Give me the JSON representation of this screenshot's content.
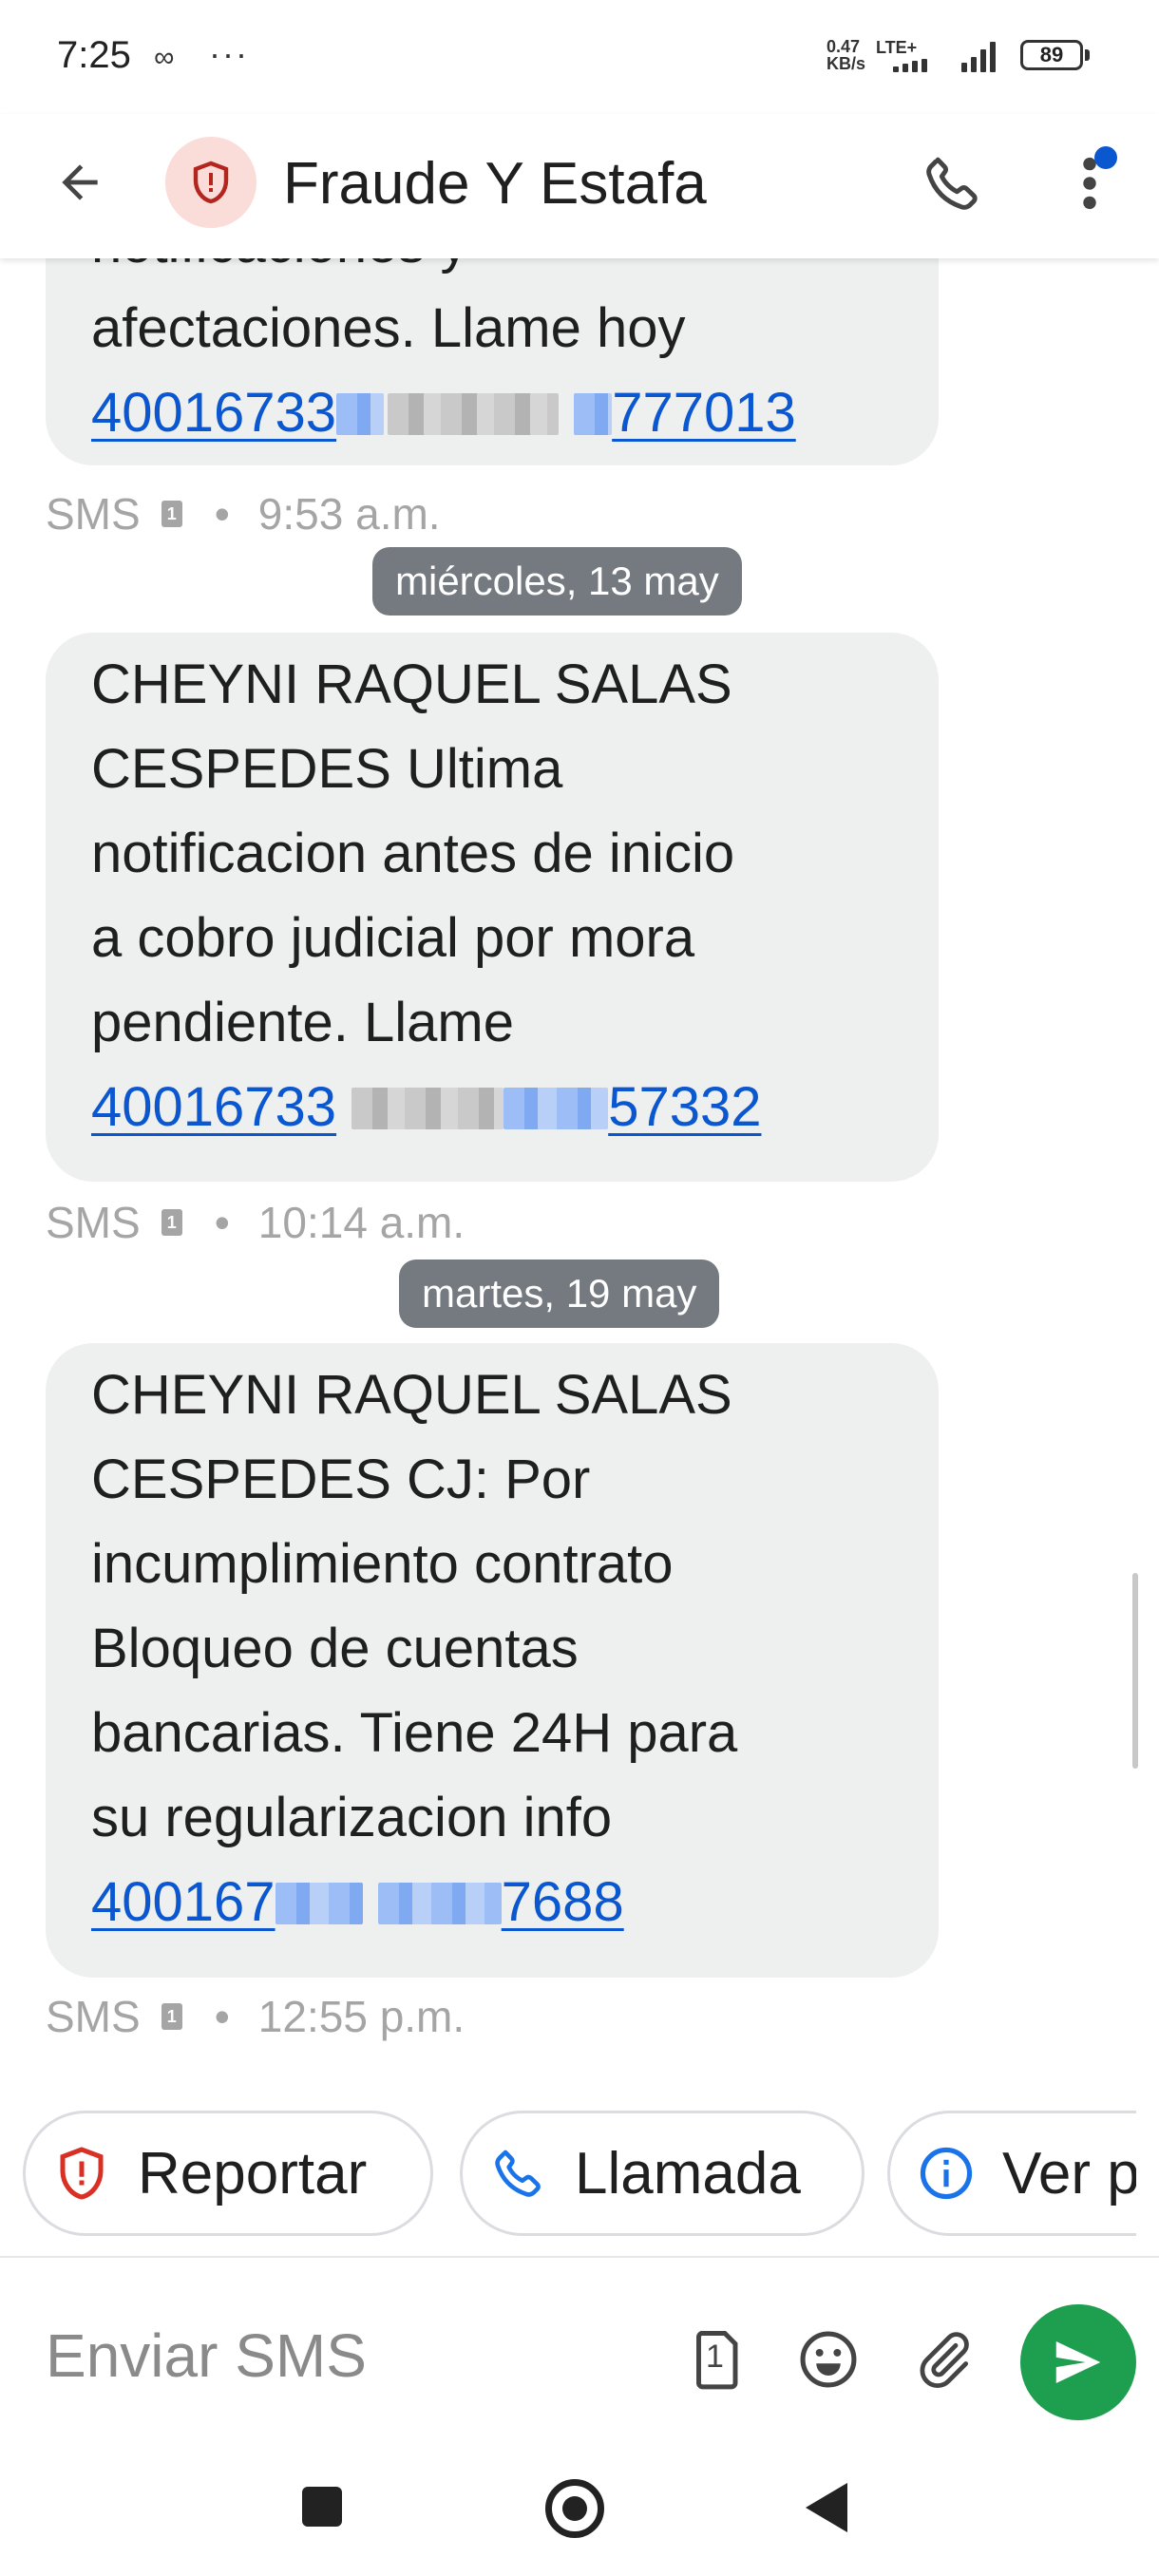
{
  "status_bar": {
    "time": "7:25",
    "voicemail_icon": "voicemail-icon",
    "more_indicator": "···",
    "speed_value": "0.47",
    "speed_unit": "KB/s",
    "network": "LTE+",
    "battery": "89"
  },
  "app_bar": {
    "contact_name": "Fraude Y Estafa",
    "avatar_icon": "shield-alert-icon",
    "avatar_bg": "#fadcd9",
    "avatar_fg": "#b3261e"
  },
  "messages": [
    {
      "lines": [
        "notificaciones y",
        "afectaciones. Llame hoy"
      ],
      "link_prefix": "40016733",
      "link_suffix": "777013",
      "type": "SMS",
      "time": "9:53 a.m."
    },
    {
      "date_chip": "miércoles, 13 may",
      "lines": [
        "CHEYNI RAQUEL SALAS",
        "CESPEDES Ultima",
        "notificacion antes de inicio",
        "a cobro judicial por mora",
        "pendiente. Llame"
      ],
      "link_prefix": "40016733",
      "link_suffix": "57332",
      "type": "SMS",
      "time": "10:14 a.m."
    },
    {
      "date_chip": "martes, 19 may",
      "lines": [
        "CHEYNI RAQUEL SALAS",
        "CESPEDES CJ: Por",
        "incumplimiento contrato",
        "Bloqueo de cuentas",
        "bancarias. Tiene 24H para",
        "su regularizacion info"
      ],
      "link_prefix": "400167",
      "link_suffix": "7688",
      "type": "SMS",
      "time": "12:55 p.m."
    }
  ],
  "suggestions": [
    {
      "label": "Reportar",
      "icon": "shield-alert-icon"
    },
    {
      "label": "Llamada",
      "icon": "phone-icon"
    },
    {
      "label": "Ver p",
      "icon": "info-icon"
    }
  ],
  "compose": {
    "placeholder": "Enviar SMS",
    "sim_badge": "1"
  },
  "colors": {
    "link": "#0b57d0",
    "bubble": "#eeefef",
    "send_button": "#1e9e4f",
    "date_chip": "#757a80"
  }
}
